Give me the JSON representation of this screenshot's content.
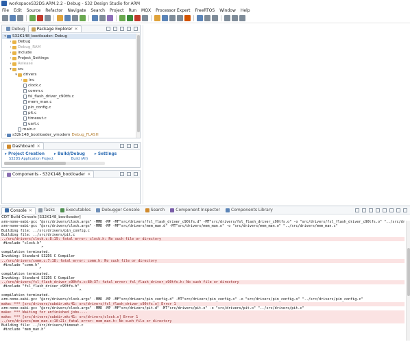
{
  "window": {
    "title": "workspaceS32DS.ARM.2.2 - Debug - S32 Design Studio for ARM"
  },
  "menu": [
    "File",
    "Edit",
    "Source",
    "Refactor",
    "Navigate",
    "Search",
    "Project",
    "Run",
    "MQX",
    "Processor Expert",
    "FreeRTOS",
    "Window",
    "Help"
  ],
  "explorer": {
    "tabs": {
      "debug": "Debug",
      "package": "Package Explorer"
    },
    "items": [
      {
        "label": "S32K148_bootloader: Debug",
        "indent": 0,
        "type": "proj",
        "arrow": "▾",
        "dim": false,
        "deco": ""
      },
      {
        "label": "Debug",
        "indent": 1,
        "type": "folder",
        "arrow": "›",
        "dim": false,
        "deco": ""
      },
      {
        "label": "Debug_RAM",
        "indent": 1,
        "type": "folder",
        "arrow": "›",
        "dim": true,
        "deco": ""
      },
      {
        "label": "include",
        "indent": 1,
        "type": "folder",
        "arrow": "›",
        "dim": false,
        "deco": ""
      },
      {
        "label": "Project_Settings",
        "indent": 1,
        "type": "folder",
        "arrow": "›",
        "dim": false,
        "deco": ""
      },
      {
        "label": "Release",
        "indent": 1,
        "type": "folder",
        "arrow": "›",
        "dim": true,
        "deco": ""
      },
      {
        "label": "src",
        "indent": 1,
        "type": "folder",
        "arrow": "▾",
        "dim": false,
        "deco": ""
      },
      {
        "label": "drivers",
        "indent": 2,
        "type": "folder",
        "arrow": "▾",
        "dim": false,
        "deco": ""
      },
      {
        "label": "inc",
        "indent": 3,
        "type": "folder",
        "arrow": "›",
        "dim": false,
        "deco": ""
      },
      {
        "label": "clock.c",
        "indent": 3,
        "type": "file",
        "arrow": "",
        "dim": false,
        "deco": ""
      },
      {
        "label": "comm.c",
        "indent": 3,
        "type": "file",
        "arrow": "",
        "dim": false,
        "deco": ""
      },
      {
        "label": "fsl_flash_driver_c90tfs.c",
        "indent": 3,
        "type": "file",
        "arrow": "",
        "dim": false,
        "deco": ""
      },
      {
        "label": "mem_man.c",
        "indent": 3,
        "type": "file",
        "arrow": "",
        "dim": false,
        "deco": ""
      },
      {
        "label": "pin_config.c",
        "indent": 3,
        "type": "file",
        "arrow": "",
        "dim": false,
        "deco": ""
      },
      {
        "label": "pit.c",
        "indent": 3,
        "type": "file",
        "arrow": "",
        "dim": false,
        "deco": ""
      },
      {
        "label": "timeout.c",
        "indent": 3,
        "type": "file",
        "arrow": "",
        "dim": false,
        "deco": ""
      },
      {
        "label": "uart.c",
        "indent": 3,
        "type": "file",
        "arrow": "",
        "dim": false,
        "deco": ""
      },
      {
        "label": "main.c",
        "indent": 2,
        "type": "file",
        "arrow": "",
        "dim": false,
        "deco": ""
      },
      {
        "label": "s32k148_bootloader_ymodem",
        "indent": 0,
        "type": "proj",
        "arrow": "›",
        "dim": false,
        "deco": "Debug_FLASH"
      }
    ]
  },
  "dashboard": {
    "tab": "Dashboard",
    "links": {
      "project_creation": "Project Creation",
      "build_debug": "Build/Debug",
      "settings": "Settings"
    },
    "sub": {
      "app_project": "S32DS Application Project",
      "build_all": "Build (All)"
    }
  },
  "components": {
    "tab": "Components - S32K148_bootloader"
  },
  "console": {
    "tabs": [
      "Console",
      "Tasks",
      "Executables",
      "Debugger Console",
      "Search",
      "Component Inspector",
      "Components Library"
    ],
    "header": "CDT Build Console [S32K148_bootloader]",
    "lines": [
      {
        "t": "arm-none-eabi-gcc \"@src/drivers/clock.args\" -MMD -MP -MF\"src/drivers/fsl_flash_driver_c90tfs.d\" -MT\"src/drivers/fsl_flash_driver_c90tfs.o\" -o \"src/drivers/fsl_flash_driver_c90tfs.o\" \"../src/dr",
        "k": "norm"
      },
      {
        "t": "arm-none-eabi-gcc \"@src/drivers/clock.args\" -MMD -MP -MF\"src/drivers/mem_man.d\" -MT\"src/drivers/mem_man.o\" -o \"src/drivers/mem_man.o\" \"../src/drivers/mem_man.c\"",
        "k": "norm"
      },
      {
        "t": "Building file: ../src/drivers/pin_config.c",
        "k": "norm"
      },
      {
        "t": "Building file: ../src/drivers/pit.c",
        "k": "norm"
      },
      {
        "t": "../src/drivers/clock.c:8:19: fatal error: clock.h: No such file or directory",
        "k": "err"
      },
      {
        "t": " #include \"clock.h\"",
        "k": "norm"
      },
      {
        "t": "                   ^",
        "k": "norm"
      },
      {
        "t": "compilation terminated.",
        "k": "norm"
      },
      {
        "t": "Invoking: Standard S32DS C Compiler",
        "k": "norm"
      },
      {
        "t": "../src/drivers/comm.c:7:18: fatal error: comm.h: No such file or directory",
        "k": "err"
      },
      {
        "t": " #include \"comm.h\"",
        "k": "norm"
      },
      {
        "t": "                  ^",
        "k": "norm"
      },
      {
        "t": "compilation terminated.",
        "k": "norm"
      },
      {
        "t": "Invoking: Standard S32DS C Compiler",
        "k": "norm"
      },
      {
        "t": "../src/drivers/fsl_flash_driver_c90tfs.c:80:37: fatal error: fsl_flash_driver_c90tfs.h: No such file or directory",
        "k": "err"
      },
      {
        "t": " #include \"fsl_flash_driver_c90tfs.h\"",
        "k": "norm"
      },
      {
        "t": "                                     ^",
        "k": "norm"
      },
      {
        "t": "compilation terminated.",
        "k": "norm"
      },
      {
        "t": "arm-none-eabi-gcc \"@src/drivers/clock.args\" -MMD -MP -MF\"src/drivers/pin_config.d\" -MT\"src/drivers/pin_config.o\" -o \"src/drivers/pin_config.o\" \"../src/drivers/pin_config.c\"",
        "k": "norm"
      },
      {
        "t": "make: *** [src/drivers/subdir.mk:41: src/drivers/fsl_flash_driver_c90tfs.o] Error 1",
        "k": "err"
      },
      {
        "t": "arm-none-eabi-gcc \"@src/drivers/clock.args\" -MMD -MP -MF\"src/drivers/pit.d\" -MT\"src/drivers/pit.o\" -o \"src/drivers/pit.o\" \"../src/drivers/pit.c\"",
        "k": "norm"
      },
      {
        "t": "make: *** Waiting for unfinished jobs....",
        "k": "err"
      },
      {
        "t": "make: *** [src/drivers/subdir.mk:41: src/drivers/clock.o] Error 1",
        "k": "err"
      },
      {
        "t": "../src/drivers/mem_man.c:10:21: fatal error: mem_man.h: No such file or directory",
        "k": "err"
      },
      {
        "t": "Building file: ../src/drivers/timeout.c",
        "k": "norm"
      },
      {
        "t": " #include \"mem_man.h\"",
        "k": "norm"
      }
    ]
  },
  "colors": {
    "error_bg": "#fbe3e3",
    "link": "#2e6db4",
    "folder": "#e8b448"
  }
}
